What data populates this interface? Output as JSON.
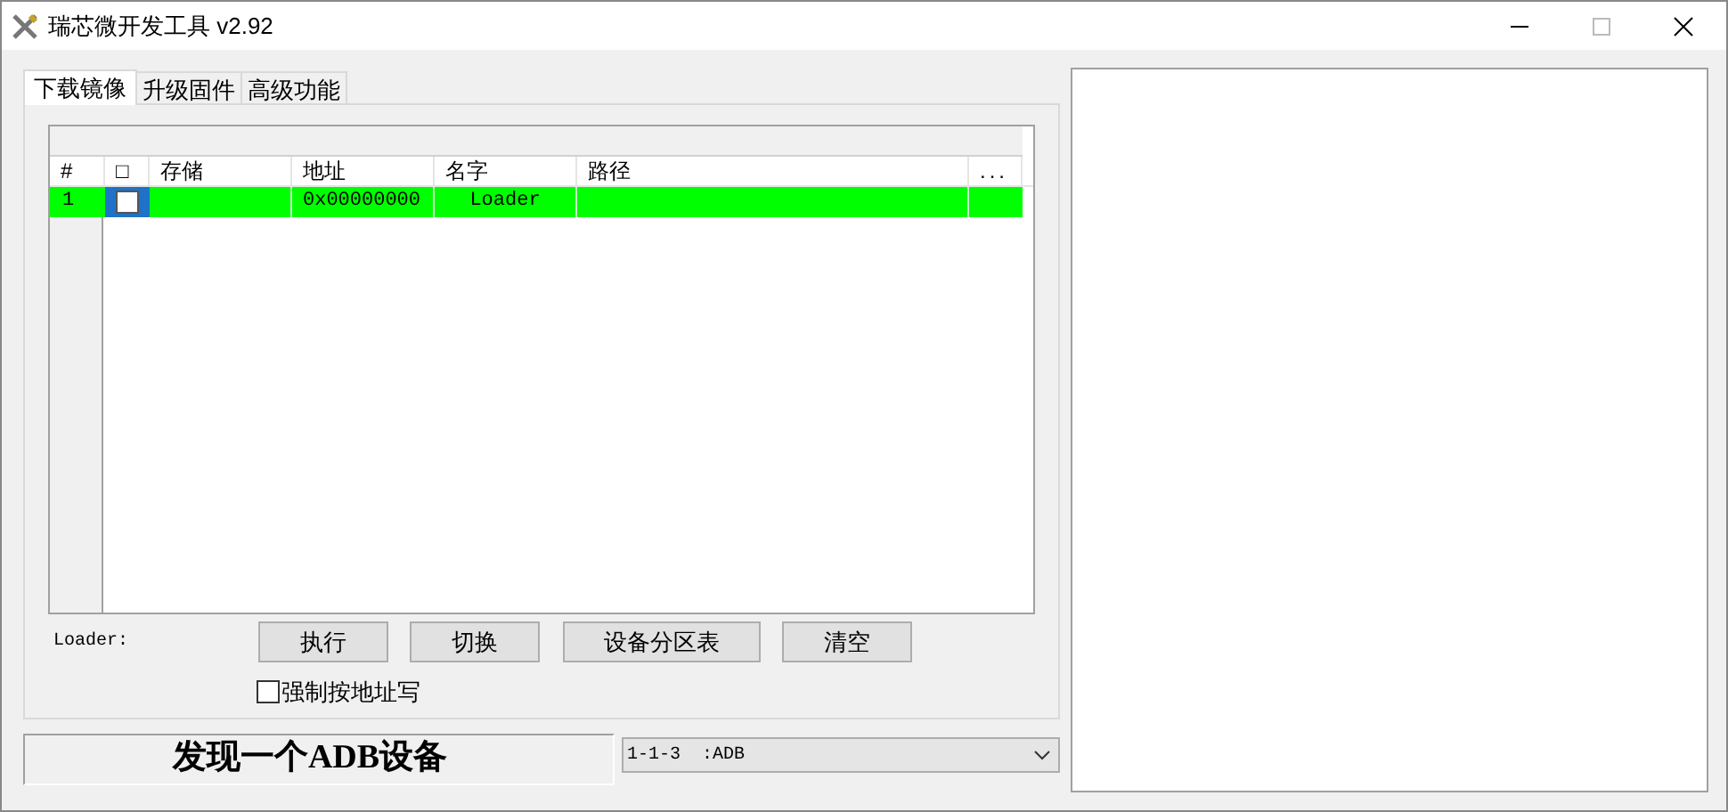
{
  "window": {
    "title": "瑞芯微开发工具 v2.92"
  },
  "tabs": [
    {
      "label": "下载镜像",
      "selected": true
    },
    {
      "label": "升级固件",
      "selected": false
    },
    {
      "label": "高级功能",
      "selected": false
    }
  ],
  "table": {
    "columns": [
      "#",
      "□",
      "存储",
      "地址",
      "名字",
      "路径",
      "..."
    ],
    "rows": [
      {
        "number": "1",
        "checked": false,
        "selected": true,
        "storage": "",
        "address": "0x00000000",
        "name": "Loader",
        "path": ""
      }
    ]
  },
  "loader_label": "Loader:",
  "buttons": [
    "执行",
    "切换",
    "设备分区表",
    "清空"
  ],
  "force_address": {
    "label": "强制按地址写",
    "checked": false
  },
  "status": "发现一个ADB设备",
  "device_select": {
    "value": "1-1-3  :ADB"
  }
}
